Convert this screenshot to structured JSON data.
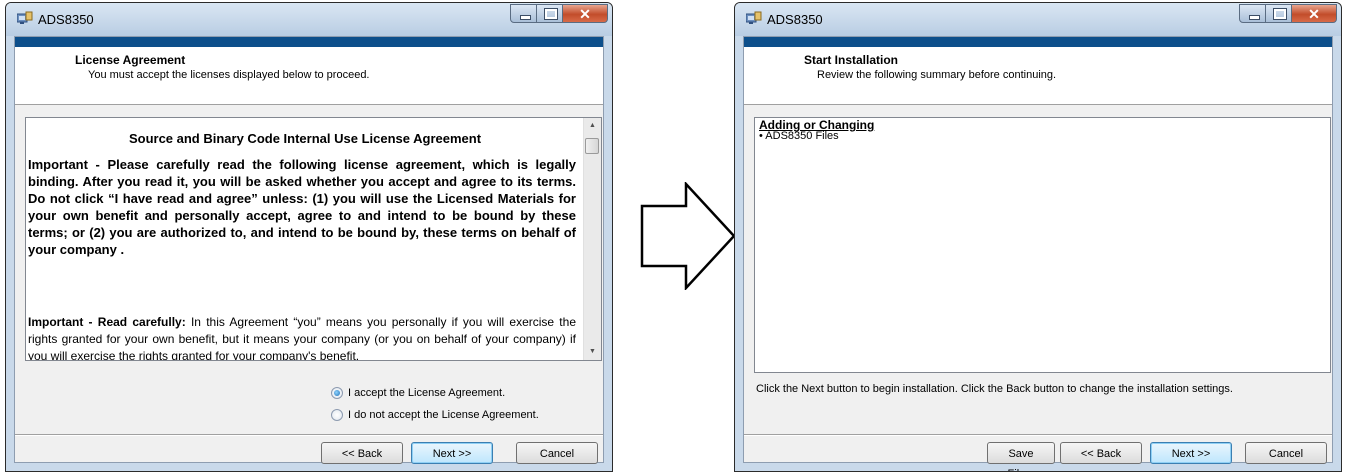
{
  "left_window": {
    "title": "ADS8350",
    "header_title": "License Agreement",
    "header_subtitle": "You must accept the licenses displayed below to proceed.",
    "license": {
      "title": "Source and Binary Code Internal Use License Agreement",
      "paragraph1": "Important - Please carefully read the following license agreement, which is legally binding.  After you read it, you will be asked whether you accept and agree to its terms.  Do not click  “I have read and agree” unless: (1) you will use the Licensed Materials for your own benefit and personally accept, agree to and intend to be bound by these terms; or (2) you are authorized to,  and intend to be bound by, these terms on behalf of your company .",
      "paragraph2_bold": "Important - Read carefully:",
      "paragraph2": " In this Agreement “you” means you personally if you will exercise the rights granted for your own benefit, but it means your company (or you on behalf of your company) if you will exercise the rights granted for your company's benefit."
    },
    "radio_accept_label": "I accept the License Agreement.",
    "radio_decline_label": "I do not accept the License Agreement.",
    "accept_selected": true,
    "buttons": {
      "back": "<< Back",
      "next": "Next >>",
      "cancel": "Cancel"
    }
  },
  "right_window": {
    "title": "ADS8350",
    "header_title": "Start Installation",
    "header_subtitle": "Review the following summary before continuing.",
    "summary_heading": "Adding or Changing",
    "summary_items": [
      "• ADS8350 Files"
    ],
    "footer_note": "Click the Next button to begin installation.  Click the Back button to change the installation settings.",
    "buttons": {
      "save": "Save File...",
      "back": "<< Back",
      "next": "Next >>",
      "cancel": "Cancel"
    }
  },
  "icons": {
    "app": "installer-app-icon",
    "minimize": "minimize-icon",
    "maximize": "maximize-icon",
    "close": "close-icon",
    "arrow": "right-arrow-icon"
  },
  "colors": {
    "header_band": "#0d4f8b",
    "close_button": "#c24d2b",
    "window_frame": "#c9d9ea"
  }
}
